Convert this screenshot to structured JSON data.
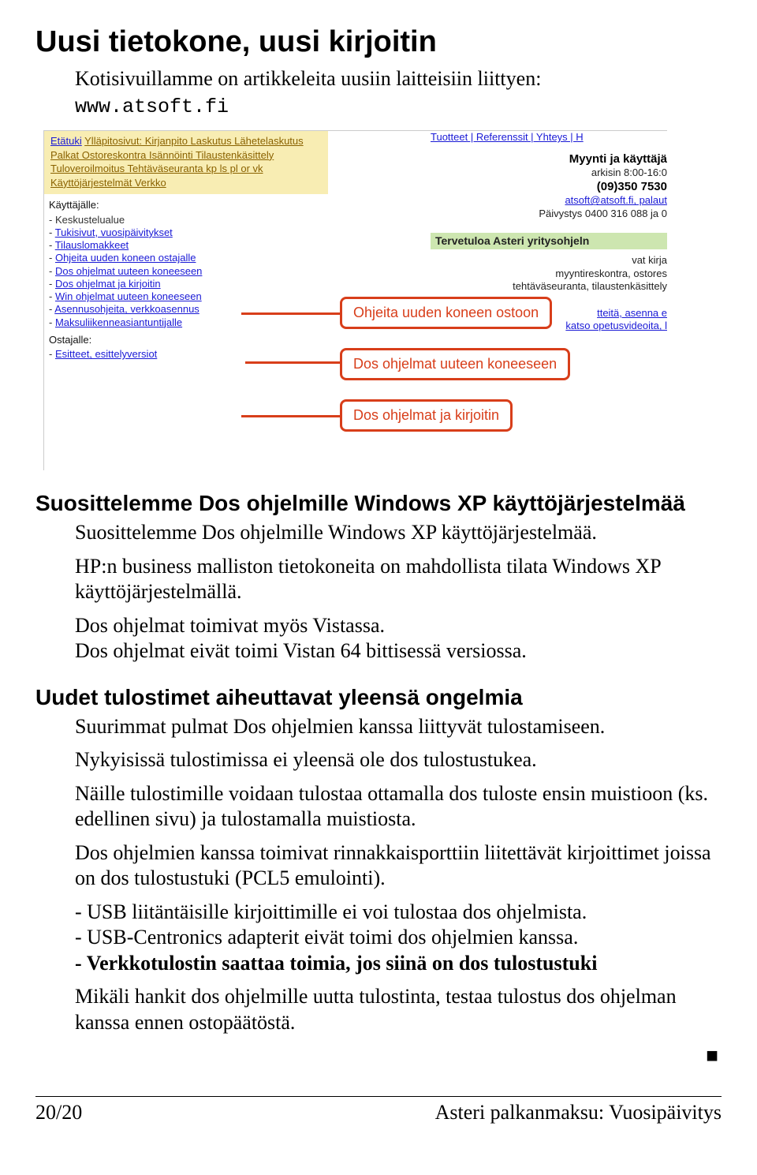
{
  "title": "Uusi tietokone, uusi kirjoitin",
  "intro": "Kotisivuillamme on artikkeleita uusiin laitteisiin liittyen:",
  "intro_url": "www.atsoft.fi",
  "screenshot": {
    "top_left_first": "Etätuki",
    "top_left_rest": "Ylläpitosivut: Kirjanpito Laskutus Lähetelaskutus Palkat Ostoreskontra Isännöinti Tilaustenkäsittely Tuloveroilmoitus Tehtäväseuranta kp ls pl or vk Käyttöjärjestelmät Verkko",
    "user_hdr": "Käyttäjälle:",
    "user_items": [
      "Keskustelualue",
      "Tukisivut, vuosipäivitykset",
      "Tilauslomakkeet",
      "Ohjeita uuden koneen ostajalle",
      "Dos ohjelmat uuteen koneeseen",
      "Dos ohjelmat ja kirjoitin",
      "Win ohjelmat uuteen koneeseen",
      "Asennusohjeita, verkkoasennus",
      "Maksuliikenneasiantuntijalle"
    ],
    "buyer_hdr": "Ostajalle:",
    "buyer_items": [
      "Esitteet, esittelyversiot"
    ],
    "topnav": "Tuotteet | Referenssit | Yhteys | H",
    "right_bold1": "Myynti ja käyttäjä",
    "right_line2": "arkisin 8:00-16:0",
    "right_bold2": "(09)350 7530",
    "right_mail": "atsoft@atsoft.fi, palaut",
    "right_line4": "Päivystys 0400 316 088 ja 0",
    "green_hdr": "Tervetuloa Asteri yritysohjeln",
    "right_frag1": "vat kirja",
    "right_frag2": "myyntireskontra, ostores",
    "right_frag3": "tehtäväseuranta, tilaustenkäsittely",
    "right_frag4": "tteitä, asenna e",
    "right_frag5": "katso opetusvideoita, l",
    "callout1": "Ohjeita uuden koneen ostoon",
    "callout2": "Dos ohjelmat uuteen koneeseen",
    "callout3": "Dos ohjelmat ja kirjoitin"
  },
  "sec1": {
    "p1": "Suosittelemme Dos ohjelmille Windows XP käyttöjärjestelmää.",
    "p2": "HP:n business malliston tietokoneita on mahdollista tilata Windows XP käyttöjärjestelmällä.",
    "p3": "Dos ohjelmat toimivat myös Vistassa.",
    "p4": "Dos ohjelmat eivät toimi Vistan 64 bittisessä versiossa."
  },
  "h2a": "Suosittelemme Dos ohjelmille Windows XP käyttöjärjestelmää",
  "h2b": "Uudet tulostimet aiheuttavat yleensä ongelmia",
  "sec2": {
    "p1": "Suurimmat pulmat Dos ohjelmien kanssa liittyvät tulostamiseen.",
    "p2": "Nykyisissä tulostimissa ei yleensä ole dos tulostustukea.",
    "p3": "Näille tulostimille voidaan tulostaa ottamalla dos tuloste ensin muistioon (ks. edellinen sivu) ja tulostamalla muistiosta.",
    "p4": "Dos ohjelmien kanssa toimivat rinnakkaisporttiin liitettävät kirjoittimet joissa on dos tulostustuki (PCL5 emulointi).",
    "p5": "- USB liitäntäisille kirjoittimille ei voi tulostaa dos ohjelmista.",
    "p6": "- USB-Centronics adapterit eivät toimi dos ohjelmien kanssa.",
    "p7": "- Verkkotulostin saattaa toimia, jos siinä on dos tulostustuki",
    "p8": "Mikäli hankit dos ohjelmille uutta tulostinta, testaa tulostus dos ohjelman kanssa ennen ostopäätöstä."
  },
  "endmark": "■",
  "footer_left": "20/20",
  "footer_right": "Asteri palkanmaksu: Vuosipäivitys"
}
